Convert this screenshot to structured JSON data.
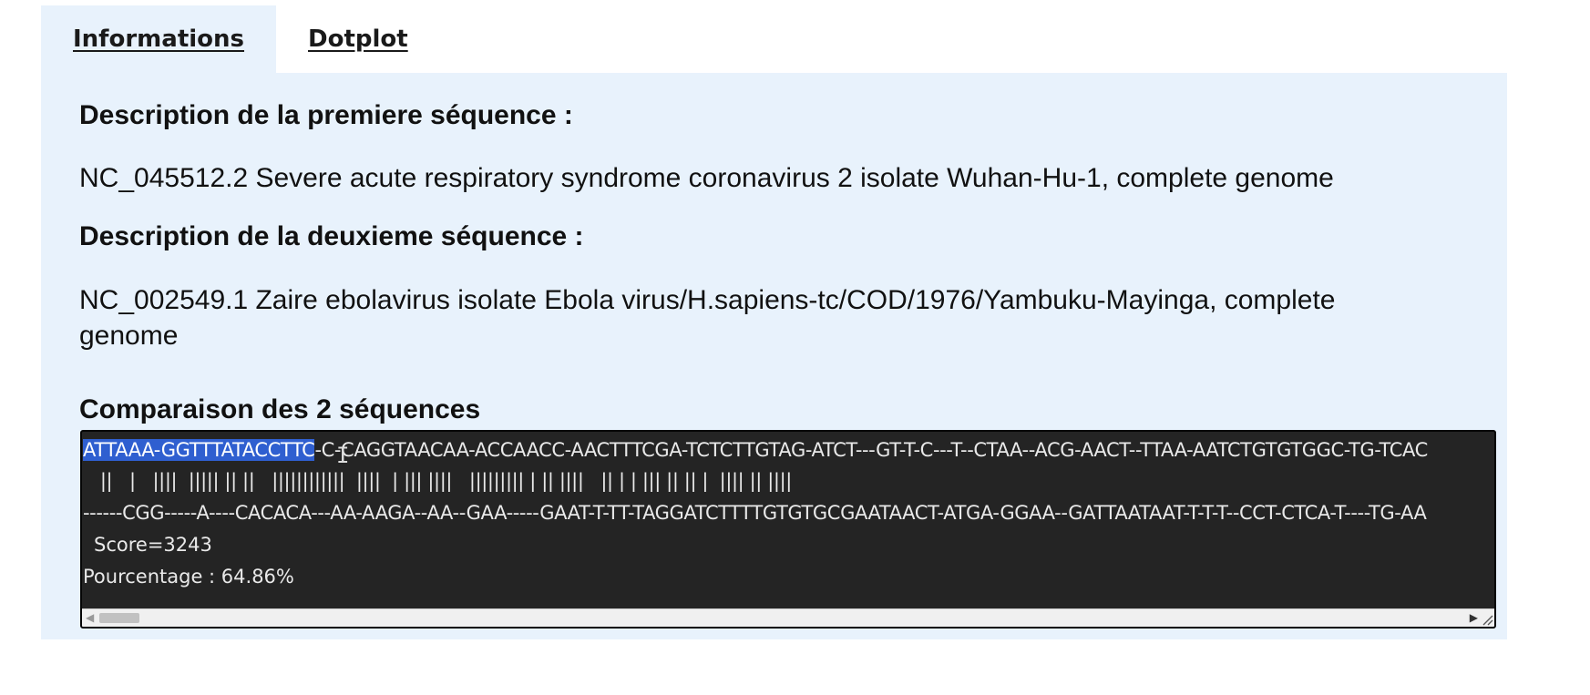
{
  "tabs": [
    {
      "label": "Informations",
      "active": true
    },
    {
      "label": "Dotplot",
      "active": false
    }
  ],
  "info": {
    "first_heading": "Description de la premiere séquence :",
    "first_description": "NC_045512.2 Severe acute respiratory syndrome coronavirus 2 isolate Wuhan-Hu-1, complete genome",
    "second_heading": "Description de la deuxieme séquence :",
    "second_description": "NC_002549.1 Zaire ebolavirus isolate Ebola virus/H.sapiens-tc/COD/1976/Yambuku-Mayinga, complete genome",
    "comparison_heading": "Comparaison des 2 séquences"
  },
  "alignment": {
    "seq1_selected": "ATTAAA-GGTTTATACCTTC",
    "seq1_rest": "-C-CAGGTAACAA-ACCAACC-AACTTTCGA-TCTCTTGTAG-ATCT---GT-T-C---T--CTAA--ACG-AACT--TTAA-AATCTGTGTGGC-TG-TCAC",
    "match_line": "   ||   |   ||||  ||||| || ||   ||||||||||||  ||||  | ||| ||||   ||||||||| | || ||||   || | | ||| || || |  |||| || ||||",
    "seq2": "------CGG-----A----CACACA---AA-AAGA--AA--GAA-----GAAT-T-TT-TAGGATCTTTTGTGTGCGAATAACT-ATGA-GGAA--GATTAATAAT-T-T-T--CCT-CTCA-T----TG-AA",
    "score": "Score=3243",
    "percentage": "Pourcentage : 64.86%"
  },
  "colors": {
    "panel_background": "#e8f2fc",
    "terminal_background": "#242424",
    "selection": "#2f5fd0"
  },
  "icons": {
    "cursor": "text-cursor-icon",
    "scroll_left": "arrow-left-icon",
    "scroll_right": "arrow-right-icon",
    "resize": "resize-grip-icon"
  }
}
